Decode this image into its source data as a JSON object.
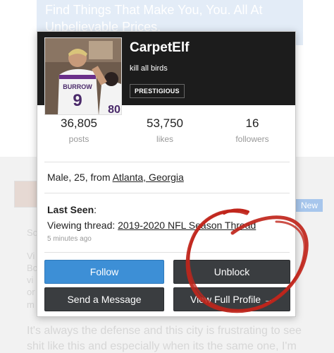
{
  "background": {
    "banner_text": "Find Things That Make You, You. All At Unbelievable Prices.",
    "new_badge": "New",
    "faded_lines": [
      "So",
      "Vi",
      "Bc",
      "vi",
      "or",
      "m",
      "It's always the defense and this city is frustrating to see",
      "shit like this and especially when its the same one, I'm"
    ]
  },
  "profile": {
    "username": "CarpetElf",
    "status_message": "kill all birds",
    "user_title": "PRESTIGIOUS",
    "photo_jersey_name": "BURROW",
    "photo_jersey_number": "9",
    "photo_jersey_number_2": "80"
  },
  "stats": [
    {
      "value": "36,805",
      "label": "posts"
    },
    {
      "value": "53,750",
      "label": "likes"
    },
    {
      "value": "16",
      "label": "followers"
    }
  ],
  "about": {
    "prefix": "Male, 25, from ",
    "location": "Atlanta, Georgia"
  },
  "last_seen": {
    "heading": "Last Seen",
    "colon": ":",
    "activity_prefix": "Viewing thread: ",
    "thread_title": "2019-2020 NFL Season Thread",
    "time_ago": "5 minutes ago"
  },
  "buttons": {
    "follow": "Follow",
    "unblock": "Unblock",
    "message": "Send a Message",
    "full_profile": "View Full Profile →"
  },
  "colors": {
    "follow_button": "#3d8fd6",
    "dark_button": "#3a3d40",
    "header_bg": "#1c1c1c",
    "scribble": "#c0251b"
  }
}
